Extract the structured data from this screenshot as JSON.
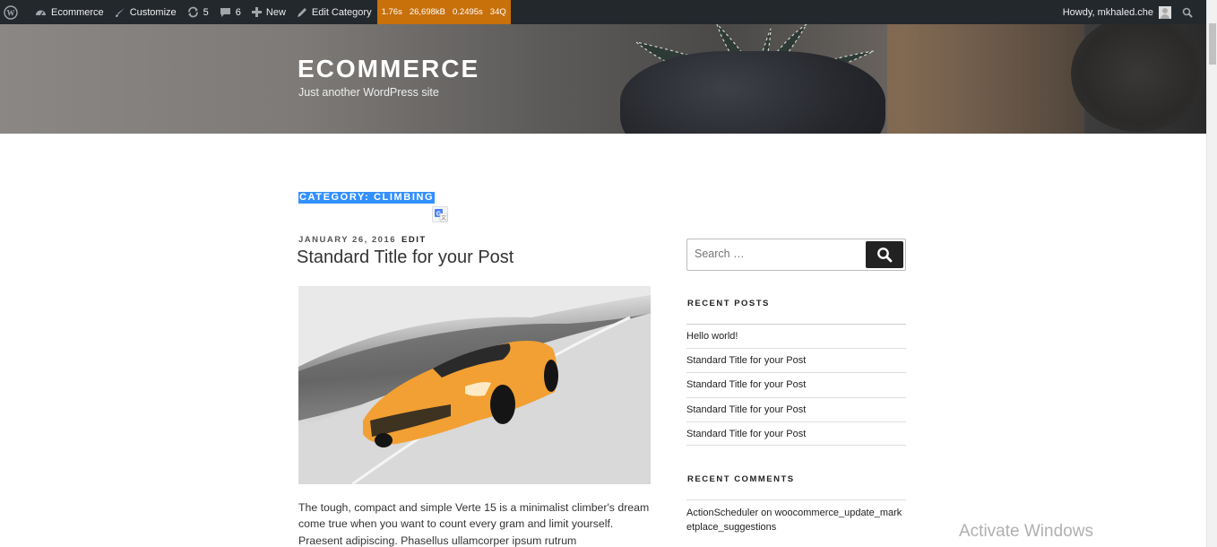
{
  "adminbar": {
    "site_name": "Ecommerce",
    "customize": "Customize",
    "updates_count": "5",
    "comments_count": "6",
    "new_label": "New",
    "edit_category": "Edit Category",
    "qm": {
      "time": "1.76s",
      "memory": "26,698kB",
      "query_time": "0.2495s",
      "queries": "34Q"
    },
    "howdy": "Howdy, mkhaled.che"
  },
  "header": {
    "site_title": "ECOMMERCE",
    "tagline": "Just another WordPress site"
  },
  "archive": {
    "title": "CATEGORY: CLIMBING"
  },
  "post": {
    "date": "JANUARY 26, 2016",
    "edit": "EDIT",
    "title": "Standard Title for your Post",
    "excerpt": "The tough, compact and simple Verte 15 is a minimalist climber's dream come true when you want to count every gram and limit yourself. Praesent adipiscing. Phasellus ullamcorper ipsum rutrum"
  },
  "sidebar": {
    "search_placeholder": "Search …",
    "recent_posts_title": "RECENT POSTS",
    "recent_posts": [
      "Hello world!",
      "Standard Title for your Post",
      "Standard Title for your Post",
      "Standard Title for your Post",
      "Standard Title for your Post"
    ],
    "recent_comments_title": "RECENT COMMENTS",
    "recent_comment": "ActionScheduler on woocommerce_update_marketplace_suggestions"
  },
  "os_overlay": {
    "activate": "Activate Windows"
  },
  "colors": {
    "adminbar": "#23282d",
    "query_monitor": "#c8700a",
    "selection": "#3390ff",
    "car": "#f2a033"
  }
}
